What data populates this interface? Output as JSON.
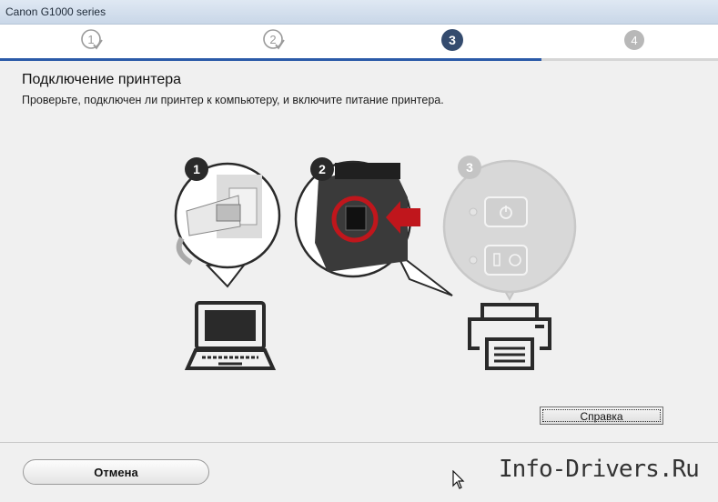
{
  "window": {
    "title": "Canon G1000 series"
  },
  "steps": [
    {
      "number": "1",
      "state": "done"
    },
    {
      "number": "2",
      "state": "done"
    },
    {
      "number": "3",
      "state": "current"
    },
    {
      "number": "4",
      "state": "pending"
    }
  ],
  "content": {
    "heading": "Подключение принтера",
    "description": "Проверьте, подключен ли принтер к компьютеру, и включите питание принтера.",
    "callouts": [
      "1",
      "2",
      "3"
    ]
  },
  "buttons": {
    "help_label": "Справка",
    "cancel_label": "Отмена"
  },
  "watermark": "Info-Drivers.Ru",
  "colors": {
    "accent": "#2b5aa8",
    "current_step": "#344b6e",
    "highlight_red": "#c0161c",
    "done_step": "#9a9a9a"
  }
}
